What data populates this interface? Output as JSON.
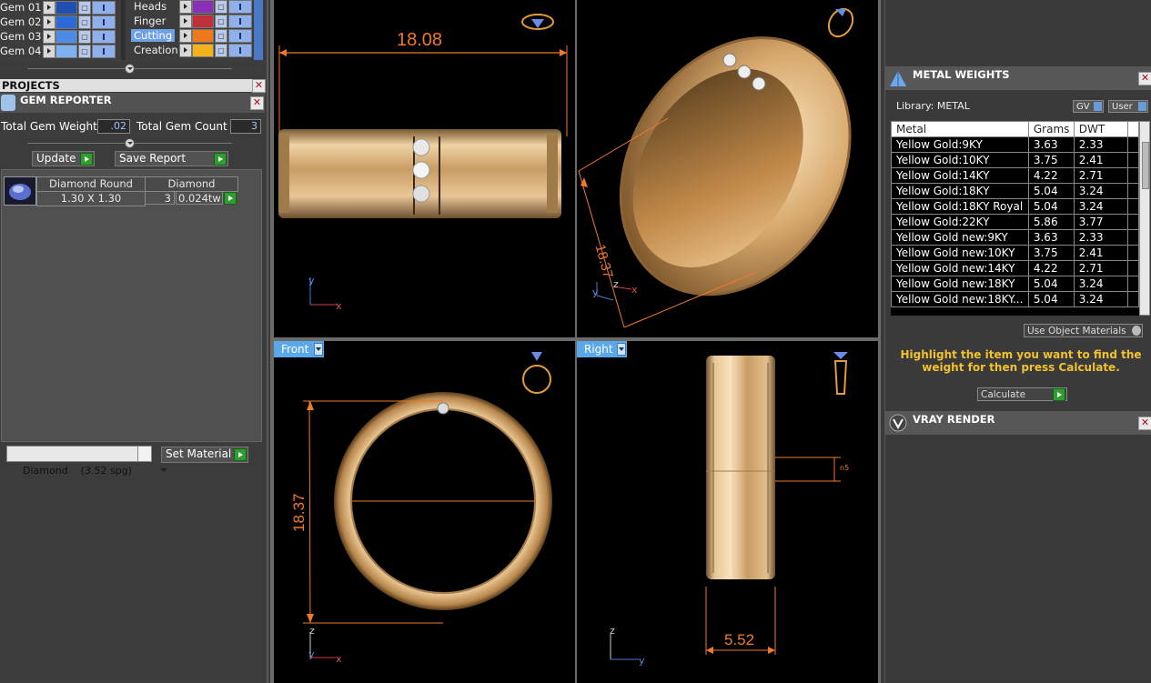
{
  "layers": {
    "gems": [
      {
        "label": "Gem 01",
        "color": "#1f4fb0"
      },
      {
        "label": "Gem 02",
        "color": "#2c6bd6"
      },
      {
        "label": "Gem 03",
        "color": "#4e8be6"
      },
      {
        "label": "Gem 04",
        "color": "#7fb0f2"
      }
    ],
    "parts": [
      {
        "label": "Heads",
        "color": "#8a2fb8",
        "selected": false
      },
      {
        "label": "Finger",
        "color": "#c0303a",
        "selected": false
      },
      {
        "label": "Cutting",
        "color": "#f07a1a",
        "selected": true
      },
      {
        "label": "Creation",
        "color": "#f4b21a",
        "selected": false
      }
    ]
  },
  "projects_title": "PROJECTS",
  "gem_reporter": {
    "title": "GEM REPORTER",
    "total_weight_label": "Total Gem Weight",
    "total_weight_value": ".02",
    "total_count_label": "Total Gem Count",
    "total_count_value": "3",
    "update_label": "Update",
    "save_report_label": "Save Report",
    "table_headers": [
      "Diamond Round",
      "Diamond"
    ],
    "row": {
      "size": "1.30 X 1.30",
      "count": "3",
      "weight": "0.024tw"
    }
  },
  "material_select": {
    "name": "Diamond",
    "spg": "(3.52 spg)"
  },
  "set_material_label": "Set Material",
  "viewports": {
    "top_dim": "18.08",
    "persp_dim": "18.37",
    "front": {
      "label": "Front",
      "dim": "18.37"
    },
    "right": {
      "label": "Right",
      "dim": "5.52",
      "small_dim": "n5"
    }
  },
  "metal_weights": {
    "title": "METAL WEIGHTS",
    "library": "Library: METAL",
    "gv_label": "GV",
    "user_label": "User",
    "headers": [
      "Metal",
      "Grams",
      "DWT"
    ],
    "rows": [
      [
        "Yellow Gold:9KY",
        "3.63",
        "2.33"
      ],
      [
        "Yellow Gold:10KY",
        "3.75",
        "2.41"
      ],
      [
        "Yellow Gold:14KY",
        "4.22",
        "2.71"
      ],
      [
        "Yellow Gold:18KY",
        "5.04",
        "3.24"
      ],
      [
        "Yellow Gold:18KY Royal",
        "5.04",
        "3.24"
      ],
      [
        "Yellow Gold:22KY",
        "5.86",
        "3.77"
      ],
      [
        "Yellow Gold new:9KY",
        "3.63",
        "2.33"
      ],
      [
        "Yellow Gold new:10KY",
        "3.75",
        "2.41"
      ],
      [
        "Yellow Gold new:14KY",
        "4.22",
        "2.71"
      ],
      [
        "Yellow Gold new:18KY",
        "5.04",
        "3.24"
      ],
      [
        "Yellow Gold new:18KY...",
        "5.04",
        "3.24"
      ]
    ],
    "use_object_materials": "Use Object Materials",
    "hint": "Highlight the item you want to find the weight for then press Calculate.",
    "calculate_label": "Calculate"
  },
  "vray_title": "VRAY RENDER",
  "colors": {
    "accent_orange": "#f07a2a",
    "gold": "#d9b27a",
    "viewport_label": "#5aa8e8",
    "hint_text": "#f2c12e"
  }
}
